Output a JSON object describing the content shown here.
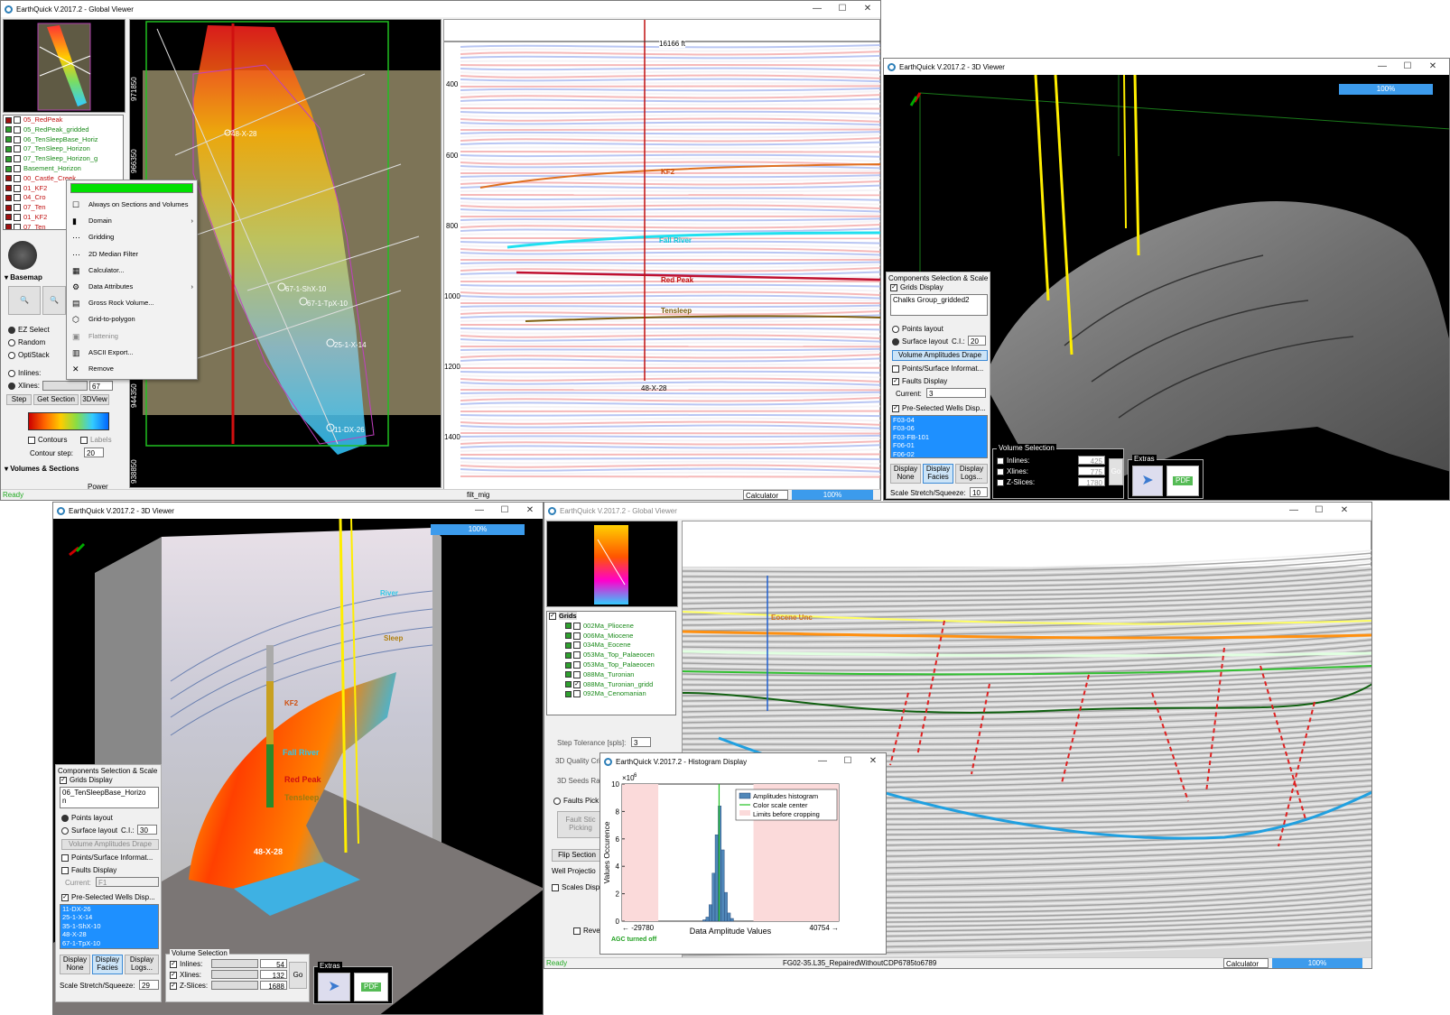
{
  "gv": {
    "title": "EarthQuick V.2017.2 - Global Viewer",
    "status": "Ready",
    "scale_bar": "16166 ft",
    "section_name": "filt_mig",
    "calculator": "Calculator",
    "progress": "100%",
    "grids": [
      {
        "label": "05_RedPeak",
        "color": "#a01010",
        "checked": false,
        "red": true
      },
      {
        "label": "05_RedPeak_gridded",
        "color": "#2fa02f",
        "checked": false,
        "red": false
      },
      {
        "label": "06_TenSleepBase_Horiz",
        "color": "#2fa02f",
        "checked": false,
        "red": false
      },
      {
        "label": "07_TenSleep_Horizon",
        "color": "#2fa02f",
        "checked": false,
        "red": false
      },
      {
        "label": "07_TenSleep_Horizon_g",
        "color": "#2fa02f",
        "checked": false,
        "red": false
      },
      {
        "label": "Basement_Horizon",
        "color": "#2fa02f",
        "checked": false,
        "red": false
      },
      {
        "label": "00_Castle_Creek",
        "color": "#a01010",
        "checked": false,
        "red": true
      },
      {
        "label": "01_KF2",
        "color": "#a01010",
        "checked": false,
        "red": true
      },
      {
        "label": "04_Cro",
        "color": "#a01010",
        "checked": false,
        "red": true
      },
      {
        "label": "07_Ten",
        "color": "#a01010",
        "checked": false,
        "red": true
      },
      {
        "label": "01_KF2",
        "color": "#a01010",
        "checked": false,
        "red": true
      },
      {
        "label": "07_Ten",
        "color": "#a01010",
        "checked": false,
        "red": true
      }
    ],
    "basemap_label": "Basemap",
    "modes": [
      "EZ Select",
      "Random",
      "OptiStack"
    ],
    "inlines": "Inlines:",
    "xlines": "Xlines:",
    "xline_value": "67",
    "step_btn": "Step",
    "get_section_btn": "Get Section",
    "view3d_btn": "3DView",
    "contours": "Contours",
    "labels": "Labels",
    "contour_step": "Contour step:",
    "contour_step_value": "20",
    "volumes_sections": "Volumes & Sections",
    "power": "Power",
    "map_coords_y": [
      "971850",
      "966350",
      "944350",
      "938850"
    ],
    "wells_map": [
      "48-X-28",
      "67-1-ShX-10",
      "67-1-TpX-10",
      "25-1-X-14",
      "11-DX-26"
    ],
    "menu": {
      "items": [
        "Always on Sections and Volumes",
        "Domain",
        "Gridding",
        "2D Median Filter",
        "Calculator...",
        "Data Attributes",
        "Gross Rock Volume...",
        "Grid-to-polygon",
        "Flattening",
        "ASCII Export...",
        "Remove"
      ]
    },
    "section_ticks": [
      "400",
      "600",
      "800",
      "1000",
      "1200",
      "1400"
    ],
    "horizons": [
      "KF2",
      "Fall River",
      "Red Peak",
      "Tensleep"
    ],
    "well_label": "48-X-28"
  },
  "v3a": {
    "title": "EarthQuick V.2017.2 - 3D Viewer",
    "progress": "100%",
    "comp_title": "Components Selection & Scale",
    "grids_display": "Grids Display",
    "grid_selected": "Chalks Group_gridded2",
    "points_layout": "Points layout",
    "surface_layout": "Surface layout",
    "ci_label": "C.I.:",
    "ci_value": "20",
    "vol_amp": "Volume Amplitudes Drape",
    "points_surface": "Points/Surface Informat...",
    "faults_display": "Faults Display",
    "current": "Current:",
    "current_value": "3",
    "pre_wells": "Pre-Selected Wells Disp...",
    "wells": [
      "F03-04",
      "F03-06",
      "F03-FB-101",
      "F06-01",
      "F06-02"
    ],
    "disp_none": "Display None",
    "disp_facies": "Display Facies",
    "disp_logs": "Display Logs...",
    "scale_stretch": "Scale Stretch/Squeeze:",
    "scale_value": "10",
    "vol_sel": "Volume Selection",
    "inlines": "Inlines:",
    "inline_value": "425",
    "xlines": "Xlines:",
    "xline_value": "775",
    "zslices": "Z-Slices:",
    "zslice_value": "1780",
    "go": "Go",
    "extras": "Extras",
    "pdf": "PDF"
  },
  "v3b": {
    "title": "EarthQuick V.2017.2 - 3D Viewer",
    "progress": "100%",
    "comp_title": "Components Selection & Scale",
    "grids_display": "Grids Display",
    "grid_selected": "06_TenSleepBase_Horizo",
    "grid_selected2": "n",
    "points_layout": "Points layout",
    "surface_layout": "Surface layout",
    "ci_label": "C.I.:",
    "ci_value": "30",
    "vol_amp": "Volume Amplitudes Drape",
    "points_surface": "Points/Surface Informat...",
    "faults_display": "Faults Display",
    "current": "Current:",
    "current_value": "F1",
    "pre_wells": "Pre-Selected Wells Disp...",
    "wells": [
      "11-DX-26",
      "25-1-X-14",
      "35-1-ShX-10",
      "48-X-28",
      "67-1-TpX-10"
    ],
    "disp_none": "Display None",
    "disp_facies": "Display Facies",
    "disp_logs": "Display Logs...",
    "scale_stretch": "Scale Stretch/Squeeze:",
    "scale_value": "29",
    "vol_sel": "Volume Selection",
    "inlines": "Inlines:",
    "inline_value": "54",
    "xlines": "Xlines:",
    "xline_value": "132",
    "zslices": "Z-Slices:",
    "zslice_value": "1688",
    "go": "Go",
    "extras": "Extras",
    "pdf": "PDF",
    "labels": [
      "River",
      "Sleep",
      "KF2",
      "Fall River",
      "Red Peak",
      "Tensleep",
      "48-X-28"
    ]
  },
  "gv2": {
    "title": "EarthQuick V.2017.2 - Global Viewer",
    "status": "Ready",
    "section_name": "FG02-35.L35_RepairedWithoutCDP6785to6789",
    "calculator": "Calculator",
    "progress": "100%",
    "tree_root": "Grids",
    "grids": [
      "002Ma_Pliocene",
      "006Ma_Miocene",
      "034Ma_Eocene",
      "053Ma_Top_Palaeocen",
      "053Ma_Top_Palaeocen",
      "088Ma_Turonian",
      "088Ma_Turonian_gridd",
      "092Ma_Cenomanian"
    ],
    "step_tol": "Step Tolerance [spls]:",
    "step_tol_value": "3",
    "quality": "3D Quality Cri",
    "seeds": "3D Seeds Ran",
    "faults_pick": "Faults Pick",
    "fault_stick": "Fault Stic Picking",
    "flip_section": "Flip Section",
    "well_proj": "Well Projectio",
    "scales_disp": "Scales Disp",
    "reve": "Reve",
    "horizon_label": "Eocene Unc"
  },
  "hist": {
    "title": "EarthQuick V.2017.2 - Histogram Display",
    "ylabel": "Values Occurence",
    "xlabel": "Data Amplitude Values",
    "left_val": "← -29780",
    "right_val": "40754 →",
    "agc": "AGC turned off",
    "exponent": "×10",
    "exp_power": "6",
    "legend": [
      "Amplitudes histogram",
      "Color scale center",
      "Limits before cropping"
    ]
  },
  "chart_data": {
    "type": "bar",
    "title": "",
    "xlabel": "Data Amplitude Values",
    "ylabel": "Values Occurence",
    "yticks": [
      "0",
      "2",
      "4",
      "6",
      "8",
      "10"
    ],
    "ylim": [
      0,
      10
    ],
    "xlim": [
      -29780,
      40754
    ],
    "series": [
      {
        "name": "Amplitudes histogram",
        "x": [
          -3000,
          -2000,
          -1000,
          0,
          1000,
          2000,
          3000,
          4000,
          5000,
          6000
        ],
        "values": [
          0.1,
          0.3,
          1.2,
          3.5,
          6.3,
          8.4,
          5.2,
          2.1,
          0.6,
          0.2
        ]
      }
    ],
    "center": 1800,
    "limits": [
      -18000,
      13000
    ]
  }
}
